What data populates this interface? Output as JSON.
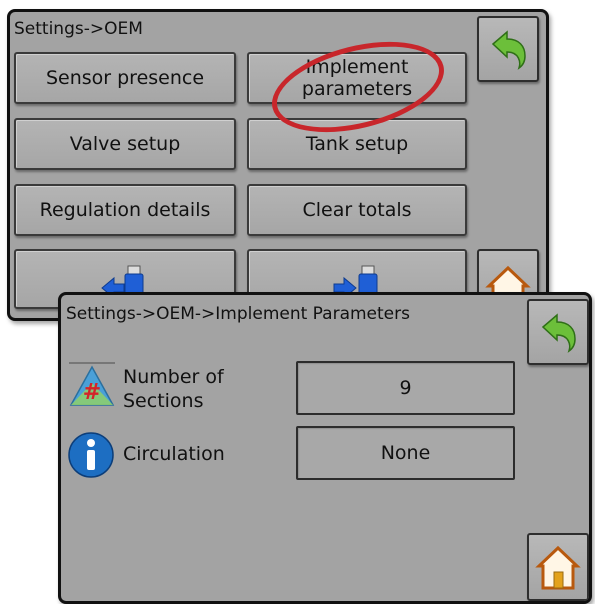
{
  "oem_screen": {
    "breadcrumb": "Settings->OEM",
    "buttons": {
      "sensor_presence": "Sensor presence",
      "implement_parameters_line1": "Implement",
      "implement_parameters_line2": "parameters",
      "valve_setup": "Valve setup",
      "tank_setup": "Tank setup",
      "regulation_details": "Regulation details",
      "clear_totals": "Clear totals"
    },
    "icons": [
      "back-arrow-icon",
      "usb-import-icon",
      "usb-export-icon",
      "home-icon"
    ]
  },
  "implement_screen": {
    "breadcrumb": "Settings->OEM->Implement Parameters",
    "number_of_sections": {
      "label_line1": "Number of",
      "label_line2": "Sections",
      "value": "9",
      "icon": "sections-hash-icon"
    },
    "circulation": {
      "label": "Circulation",
      "value": "None",
      "icon": "info-icon"
    },
    "icons": [
      "back-arrow-icon",
      "home-icon"
    ]
  },
  "colors": {
    "panel_bg": "#a3a3a3",
    "highlight_oval": "#c8262b",
    "back_arrow": "#6cbf3a",
    "usb_blue": "#1f5fd6"
  }
}
